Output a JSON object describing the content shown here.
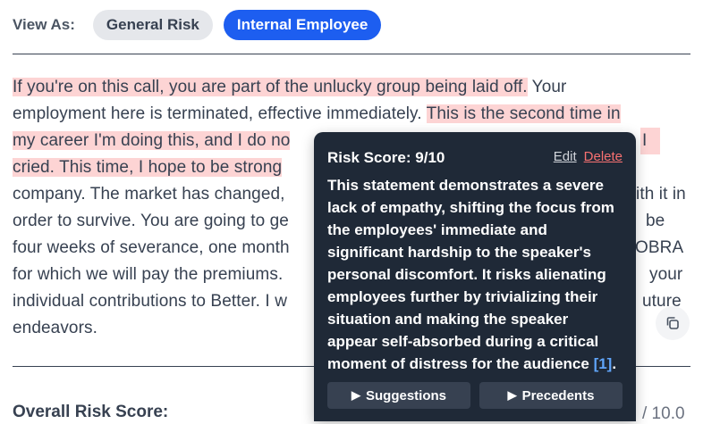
{
  "view_as": {
    "label": "View As:",
    "options": [
      "General Risk",
      "Internal Employee"
    ],
    "selected": "Internal Employee"
  },
  "transcript": {
    "lines": [
      [
        {
          "t": "If you're on this call, you are part of the unlucky group being laid off.",
          "hl": true
        },
        {
          "t": " Your",
          "hl": false
        }
      ],
      [
        {
          "t": "employment here is terminated, effective immediately. ",
          "hl": false
        },
        {
          "t": "This is the second time in",
          "hl": true
        }
      ],
      [
        {
          "t": "my career I'm doing this, and I do no",
          "hl": true
        },
        {
          "t": "",
          "hl": false
        },
        {
          "t": "I",
          "hl": true
        }
      ],
      [
        {
          "t": "cried. This time, I hope to be strong",
          "hl": true
        },
        {
          "t": "",
          "hl": false
        }
      ],
      [
        {
          "t": "company. The market has changed,",
          "hl": false
        },
        {
          "t": "ith it in",
          "hl": false
        }
      ],
      [
        {
          "t": "order to survive. You are going to ge",
          "hl": false
        },
        {
          "t": "be",
          "hl": false
        }
      ],
      [
        {
          "t": "four weeks of severance, one month",
          "hl": false
        },
        {
          "t": "OBRA",
          "hl": false
        }
      ],
      [
        {
          "t": "for which we will pay the premiums.",
          "hl": false
        },
        {
          "t": "your",
          "hl": false
        }
      ],
      [
        {
          "t": "individual contributions to Better. I w",
          "hl": false
        },
        {
          "t": "uture",
          "hl": false
        }
      ],
      [
        {
          "t": "endeavors.",
          "hl": false
        }
      ]
    ]
  },
  "copy_icon": "copy-icon",
  "overall": {
    "label": "Overall Risk Score:",
    "max_text": "/ 10.0"
  },
  "popover": {
    "title": "Risk Score: 9/10",
    "edit": "Edit",
    "delete": "Delete",
    "body_lines": [
      "This statement demonstrates a severe",
      "lack of empathy, shifting the focus from",
      "the employees' immediate and",
      "significant hardship to the speaker's",
      "personal discomfort. It risks alienating",
      "employees further by trivializing their",
      "situation and making the speaker",
      "appear self-absorbed during a critical"
    ],
    "last_line_prefix": "moment of distress for the audience ",
    "citation": "[1]",
    "last_line_suffix": ".",
    "suggestions_label": "Suggestions",
    "precedents_label": "Precedents"
  },
  "colors": {
    "accent": "#1d5ef0",
    "highlight": "#fdd4d4",
    "popover_bg": "#1f2937",
    "delete": "#f87171",
    "citation": "#60a5fa"
  }
}
